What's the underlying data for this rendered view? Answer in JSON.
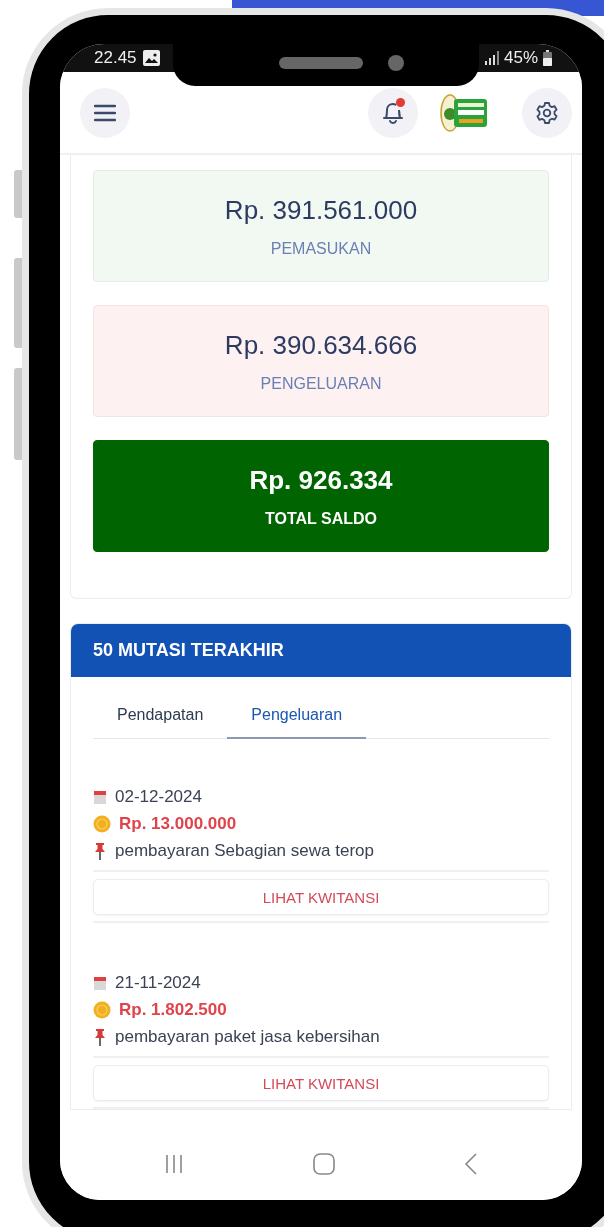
{
  "status_bar": {
    "time": "22.45",
    "battery": "45%"
  },
  "header": {
    "has_notification": true
  },
  "summary": [
    {
      "kind": "income",
      "amount": "Rp. 391.561.000",
      "label": "PEMASUKAN"
    },
    {
      "kind": "expense",
      "amount": "Rp. 390.634.666",
      "label": "PENGELUARAN"
    },
    {
      "kind": "total",
      "amount": "Rp. 926.334",
      "label": "TOTAL SALDO"
    }
  ],
  "mutations": {
    "title": "50 MUTASI TERAKHIR",
    "tabs": [
      {
        "label": "Pendapatan",
        "selected": false
      },
      {
        "label": "Pengeluaran",
        "selected": true
      }
    ],
    "items": [
      {
        "date": "02-12-2024",
        "amount": "Rp. 13.000.000",
        "description": "pembayaran Sebagian sewa terop",
        "button": "LIHAT KWITANSI"
      },
      {
        "date": "21-11-2024",
        "amount": "Rp. 1.802.500",
        "description": "pembayaran paket jasa kebersihan",
        "button": "LIHAT KWITANSI"
      }
    ]
  }
}
